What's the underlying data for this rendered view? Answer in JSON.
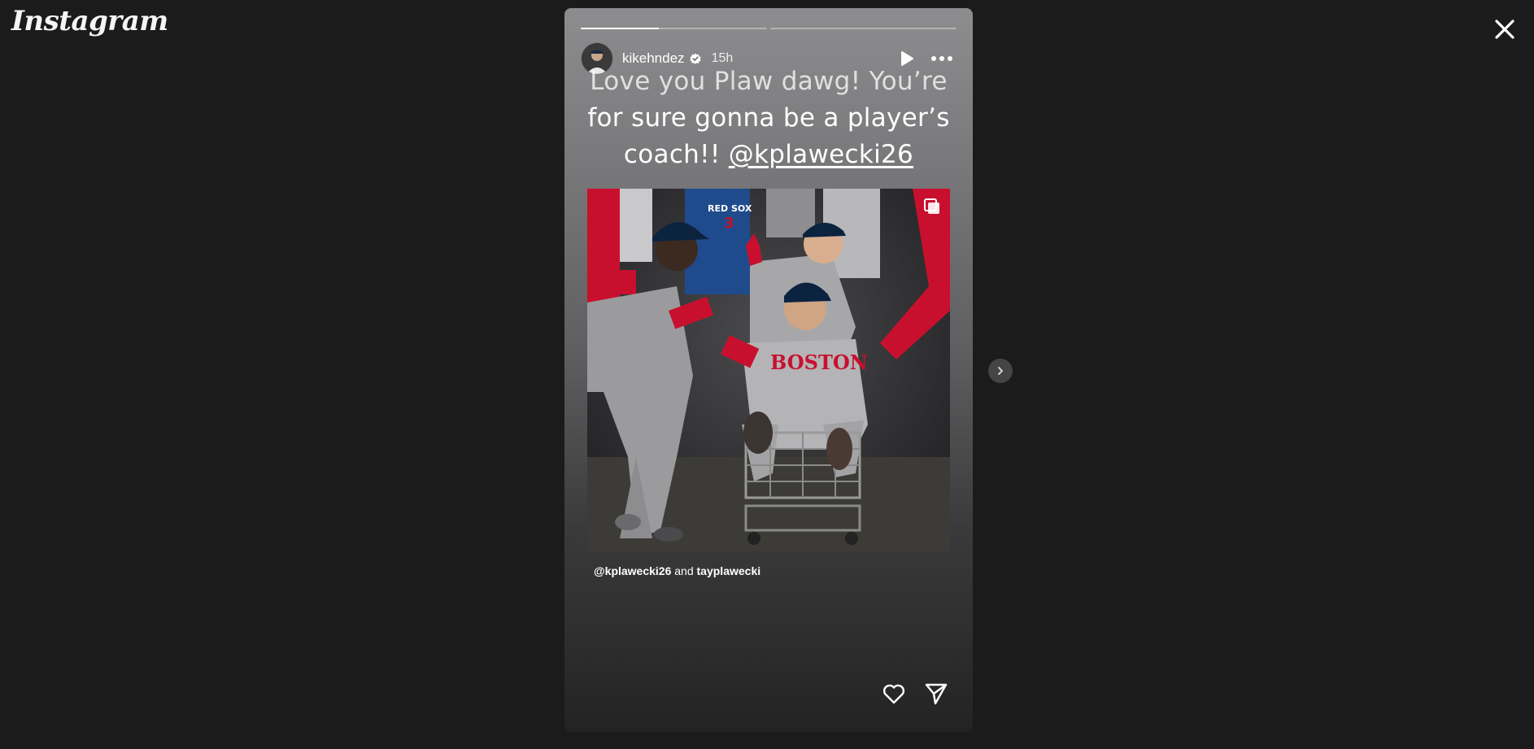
{
  "app": {
    "logo_text": "Instagram"
  },
  "story": {
    "progress": [
      {
        "fill": 0.42
      },
      {
        "fill": 0.0
      }
    ],
    "header": {
      "username": "kikehndez",
      "verified": true,
      "time_ago": "15h"
    },
    "caption": {
      "line1": "Love you Plaw dawg! You’re",
      "line2": "for sure gonna be a player’s",
      "line3_prefix": "coach!! ",
      "line3_mention": "@kplawecki26"
    },
    "tags": {
      "first": "@kplawecki26",
      "joiner": " and ",
      "second": "tayplawecki"
    }
  },
  "icons": {
    "close": "close-icon",
    "play": "play-icon",
    "more": "more-icon",
    "like": "heart-icon",
    "share": "send-icon",
    "next": "chevron-right-icon",
    "verified": "verified-badge-icon",
    "multi": "multi-photo-icon"
  },
  "colors": {
    "page_bg": "#1b1b1b",
    "verified_fill": "#ffffff",
    "team_red": "#c8102e",
    "navy": "#0c2340",
    "road_gray": "#9a9a9c"
  }
}
